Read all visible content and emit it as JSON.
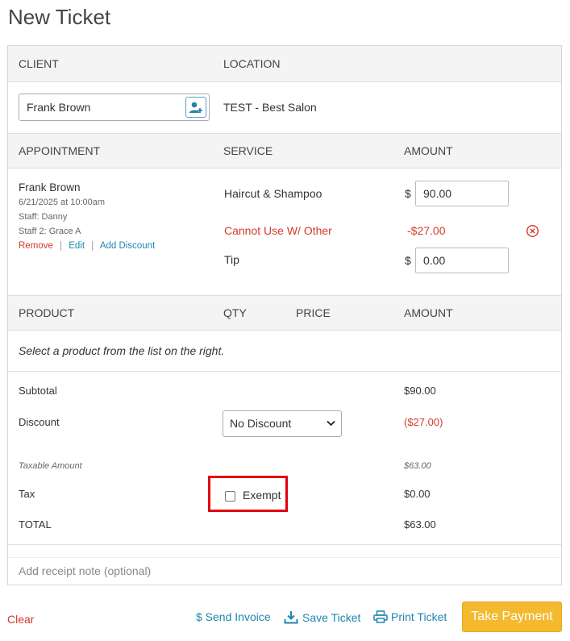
{
  "page": {
    "title": "New Ticket"
  },
  "client_section": {
    "client_header": "CLIENT",
    "location_header": "LOCATION",
    "client_name": "Frank Brown",
    "location": "TEST - Best Salon"
  },
  "appointment_section": {
    "headers": {
      "appointment": "APPOINTMENT",
      "service": "SERVICE",
      "amount": "AMOUNT"
    },
    "client_name": "Frank Brown",
    "datetime": "6/21/2025 at 10:00am",
    "staff": "Staff: Danny",
    "staff2": "Staff 2: Grace A",
    "actions": {
      "remove": "Remove",
      "edit": "Edit",
      "add_discount": "Add Discount",
      "separator": "|"
    },
    "service_name": "Haircut & Shampoo",
    "currency_symbol": "$",
    "service_amount": "90.00",
    "discount_name": "Cannot Use W/ Other",
    "discount_amount": "-$27.00",
    "tip_label": "Tip",
    "tip_amount": "0.00"
  },
  "product_section": {
    "headers": {
      "product": "PRODUCT",
      "qty": "QTY",
      "price": "PRICE",
      "amount": "AMOUNT"
    },
    "empty_message": "Select a product from the list on the right."
  },
  "totals": {
    "subtotal_label": "Subtotal",
    "subtotal_value": "$90.00",
    "discount_label": "Discount",
    "discount_select": "No Discount",
    "discount_value": "($27.00)",
    "taxable_label": "Taxable Amount",
    "taxable_value": "$63.00",
    "tax_label": "Tax",
    "exempt_label": "Exempt",
    "tax_value": "$0.00",
    "total_label": "TOTAL",
    "total_value": "$63.00"
  },
  "receipt_note": {
    "placeholder": "Add receipt note (optional)"
  },
  "footer": {
    "clear": "Clear",
    "send_invoice": "$ Send Invoice",
    "save_ticket": "Save Ticket",
    "print_ticket": "Print Ticket",
    "take_payment": "Take Payment"
  },
  "colors": {
    "accent": "#1e86b0",
    "danger": "#d33a2c",
    "payment_button": "#f4b92f",
    "highlight_box": "#e3000f"
  }
}
